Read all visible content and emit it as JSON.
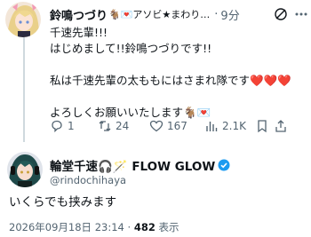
{
  "reply_tweet": {
    "display_name": "鈴鳴つづり",
    "name_badges": "🐐💌アソビ★まわり…",
    "separator": "·",
    "timestamp": "9分",
    "lines": [
      "千速先輩!!!",
      "はじめまして!!鈴鳴つづりです!!",
      "",
      "私は千速先輩の太ももにはさまれ隊です",
      "",
      "よろしくお願いいたします🐐💌"
    ],
    "hearts": "❤️❤️❤️",
    "actions": {
      "replies": "1",
      "reposts": "24",
      "likes": "167",
      "views": "2.1K"
    }
  },
  "main_tweet": {
    "display_name": "輪堂千速🎧🪄 FLOW GLOW",
    "handle": "@rindochihaya",
    "text": "いくらでも挟みます",
    "date": "2026年09月18日 23:14",
    "dot": "·",
    "view_count": "482",
    "view_label": "表示"
  },
  "colors": {
    "text": "#0f1419",
    "muted": "#536471",
    "verified": "#1d9bf0",
    "thread": "#cfd9de"
  }
}
